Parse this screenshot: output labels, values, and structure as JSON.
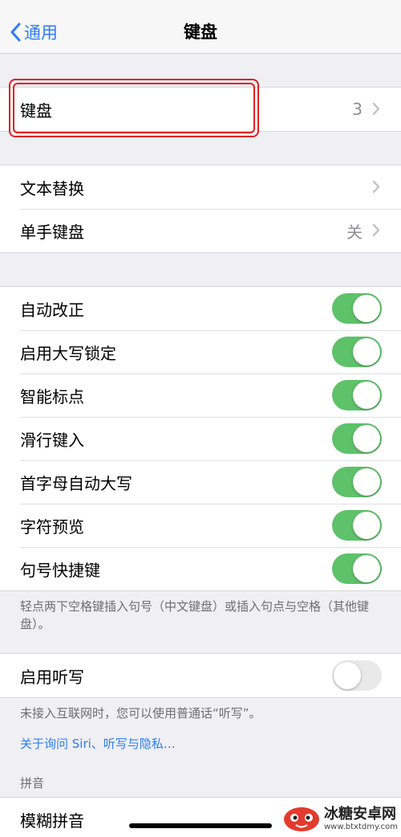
{
  "nav": {
    "back_label": "通用",
    "title": "键盘"
  },
  "keyboards": {
    "label": "键盘",
    "value": "3"
  },
  "group2": {
    "text_replacement": "文本替换",
    "one_handed": "单手键盘",
    "one_handed_value": "关"
  },
  "toggles": [
    {
      "label": "自动改正",
      "on": true
    },
    {
      "label": "启用大写锁定",
      "on": true
    },
    {
      "label": "智能标点",
      "on": true
    },
    {
      "label": "滑行键入",
      "on": true
    },
    {
      "label": "首字母自动大写",
      "on": true
    },
    {
      "label": "字符预览",
      "on": true
    },
    {
      "label": "句号快捷键",
      "on": true
    }
  ],
  "period_note": "轻点两下空格键插入句号（中文键盘）或插入句点与空格（其他键盘）。",
  "dictation": {
    "label": "启用听写",
    "on": false
  },
  "dictation_note": "未接入互联网时，您可以使用普通话“听写”。",
  "privacy_link": "关于询问 Siri、听写与隐私…",
  "pinyin": {
    "header": "拼音",
    "fuzzy": "模糊拼音"
  },
  "watermark": {
    "main": "冰糖安卓网",
    "sub": "www.btxtdmy.com"
  },
  "colors": {
    "accent": "#2f7cf6",
    "switch_on": "#5ec26a",
    "highlight": "#e02020"
  }
}
